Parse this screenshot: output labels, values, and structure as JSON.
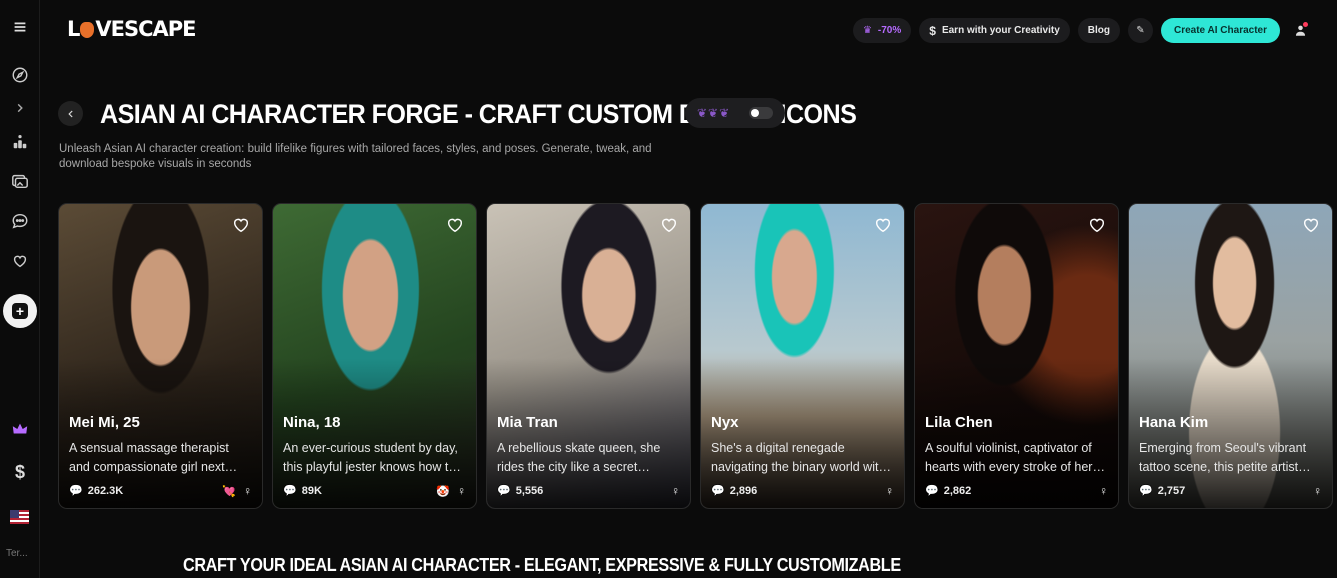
{
  "brand": {
    "logo_text_left": "L",
    "logo_text_right": "VESCAPE"
  },
  "sidebar": {
    "terms_label": "Ter..."
  },
  "topbar": {
    "discount_label": "-70%",
    "earn_label": "Earn with your Creativity",
    "blog_label": "Blog",
    "create_label": "Create AI Character"
  },
  "page": {
    "title": "ASIAN AI CHARACTER FORGE - CRAFT CUSTOM DIGITAL ICONS",
    "subtitle": "Unleash Asian AI character creation: build lifelike figures with tailored faces, styles, and poses. Generate, tweak, and download bespoke visuals in seconds",
    "section_heading": "CRAFT YOUR IDEAL ASIAN AI CHARACTER - ELEGANT, EXPRESSIVE & FULLY CUSTOMIZABLE"
  },
  "cards": [
    {
      "name": "Mei Mi, 25",
      "desc": "A sensual massage therapist and compassionate girl next door.",
      "count": "262.3K",
      "badge": "💘"
    },
    {
      "name": "Nina, 18",
      "desc": "An ever-curious student by day, this playful jester knows how to have fun.",
      "count": "89K",
      "badge": "🤡"
    },
    {
      "name": "Mia Tran",
      "desc": "A rebellious skate queen, she rides the city like a secret weapon.",
      "count": "5,556",
      "badge": ""
    },
    {
      "name": "Nyx",
      "desc": "She's a digital renegade navigating the binary world with style.",
      "count": "2,896",
      "badge": ""
    },
    {
      "name": "Lila Chen",
      "desc": "A soulful violinist, captivator of hearts with every stroke of her bow.",
      "count": "2,862",
      "badge": ""
    },
    {
      "name": "Hana Kim",
      "desc": "Emerging from Seoul's vibrant tattoo scene, this petite artist shines.",
      "count": "2,757",
      "badge": ""
    }
  ]
}
